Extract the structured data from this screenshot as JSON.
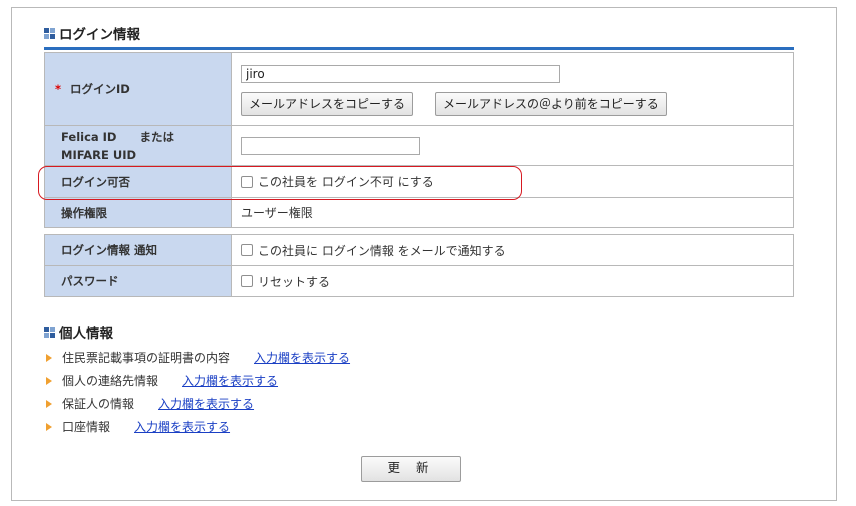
{
  "login_section": {
    "title": "ログイン情報",
    "login_id": {
      "required_mark": "*",
      "label": "ログインID",
      "value": "jiro",
      "copy_email_button": "メールアドレスをコピーする",
      "copy_before_at_button": "メールアドレスの＠より前をコピーする"
    },
    "felica": {
      "label_line1": "Felica ID　　または",
      "label_line2": "MIFARE UID",
      "value": ""
    },
    "login_permission": {
      "label": "ログイン可否",
      "checkbox_text": "この社員を ログイン不可 にする"
    },
    "authority": {
      "label": "操作権限",
      "value": "ユーザー権限"
    },
    "notify": {
      "label": "ログイン情報 通知",
      "checkbox_text": "この社員に ログイン情報 をメールで通知する"
    },
    "password": {
      "label": "パスワード",
      "checkbox_text": "リセットする"
    }
  },
  "personal_section": {
    "title": "個人情報",
    "items": [
      {
        "label": "住民票記載事項の証明書の内容",
        "link": "入力欄を表示する"
      },
      {
        "label": "個人の連絡先情報",
        "link": "入力欄を表示する"
      },
      {
        "label": "保証人の情報",
        "link": "入力欄を表示する"
      },
      {
        "label": "口座情報",
        "link": "入力欄を表示する"
      }
    ]
  },
  "update_button": "更 新",
  "colors": {
    "label_bg": "#c9d8ef",
    "accent_line": "#2a6ebf",
    "highlight": "#d71921",
    "link": "#1a3fc4",
    "bullet": "#f0a030"
  }
}
